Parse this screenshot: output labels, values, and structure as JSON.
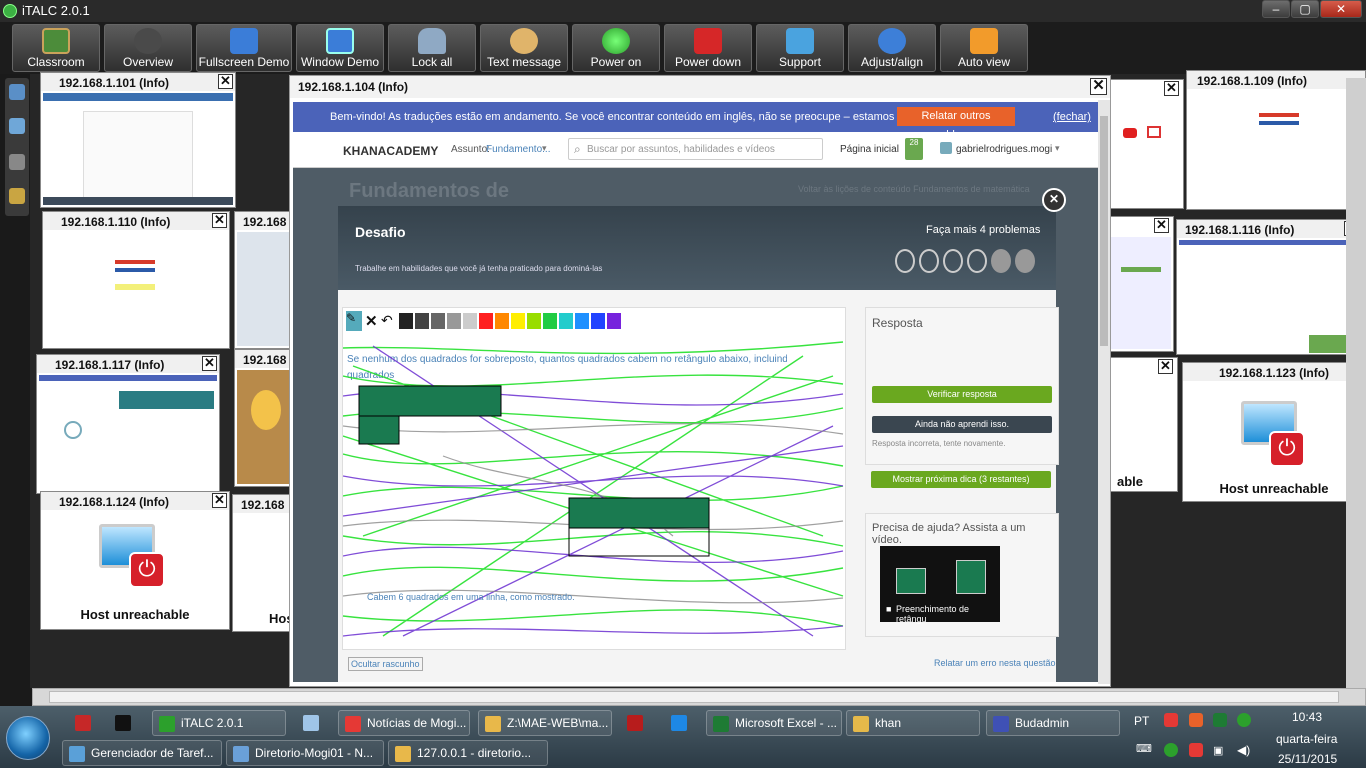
{
  "window": {
    "title": "iTALC 2.0.1",
    "controls": {
      "min": "‒",
      "max": "▢",
      "close": "✕"
    }
  },
  "toolbar": [
    {
      "label": "Classroom",
      "icon": "classroom-icon",
      "color": "#4c8c3a"
    },
    {
      "label": "Overview",
      "icon": "binoculars-icon",
      "color": "#4a4a4a"
    },
    {
      "label": "Fullscreen Demo",
      "icon": "fullscreen-demo-icon",
      "color": "#3b7dd8"
    },
    {
      "label": "Window Demo",
      "icon": "window-demo-icon",
      "color": "#3b7dd8"
    },
    {
      "label": "Lock all",
      "icon": "lock-icon",
      "color": "#8fa9c4"
    },
    {
      "label": "Text message",
      "icon": "text-message-icon",
      "color": "#e0b46a"
    },
    {
      "label": "Power on",
      "icon": "power-on-icon",
      "color": "#2ca02c"
    },
    {
      "label": "Power down",
      "icon": "power-down-icon",
      "color": "#d62728"
    },
    {
      "label": "Support",
      "icon": "support-icon",
      "color": "#4aa3df"
    },
    {
      "label": "Adjust/align",
      "icon": "adjust-align-icon",
      "color": "#3d7fd8"
    },
    {
      "label": "Auto view",
      "icon": "auto-view-icon",
      "color": "#f29b2b"
    }
  ],
  "thumbs": {
    "t101": "192.168.1.101 (Info)",
    "t110": "192.168.1.110 (Info)",
    "t117": "192.168.1.117 (Info)",
    "t124": "192.168.1.124 (Info)",
    "t109": "192.168.1.109 (Info)",
    "t116": "192.168.1.116 (Info)",
    "t123": "192.168.1.123 (Info)",
    "p1": "192.168",
    "p2": "192.168",
    "p3": "192.168",
    "unreach": "Host unreachable",
    "hos": "Hos",
    "able": "able",
    "close": "✕"
  },
  "main": {
    "title": "192.168.1.104 (Info)",
    "banner": "Bem-vindo! As traduções estão em andamento. Se você encontrar conteúdo em inglês, não se preocupe – estamos trabalhando nisso.",
    "report_other": "Relatar outros problemas",
    "close_banner": "(fechar)",
    "logo": "KHANACADEMY",
    "subject_label": "Assunto:",
    "subject_value": "Fundamento...",
    "search_placeholder": "Buscar por assuntos, habilidades e vídeos",
    "home": "Página inicial",
    "points": "28",
    "user": "gabrielrodrigues.mogi",
    "page_title": "Fundamentos de",
    "crumb": "Voltar às lições de conteúdo Fundamentos de matemática",
    "challenge_title": "Desafio",
    "challenge_sub": "Trabalhe em habilidades que você já tenha praticado para dominá-las",
    "do_more": "Faça mais 4 problemas",
    "question": "Se nenhum dos quadrados for sobreposto, quantos quadrados cabem no retângulo abaixo, incluindo os mostrados?",
    "unit": "quadrados",
    "hint_text": "Cabem 6 quadrados em uma linha, como mostrado.",
    "hide_scratch": "Ocultar rascunho",
    "report_error": "Relatar um erro nesta questão",
    "answer_label": "Resposta",
    "check_btn": "Verificar resposta",
    "not_learned_btn": "Ainda não aprendi isso.",
    "incorrect": "Resposta incorreta, tente novamente.",
    "next_hint_btn": "Mostrar próxima dica (3 restantes)",
    "help_title": "Precisa de ajuda? Assista a um vídeo.",
    "video_title": "Preenchimento de retângu",
    "modal_close": "✕",
    "palette": [
      "#222222",
      "#444444",
      "#666666",
      "#999999",
      "#cccccc",
      "#ff2020",
      "#ff8800",
      "#ffee00",
      "#99dd00",
      "#22cc44",
      "#22cccc",
      "#1e90ff",
      "#2244ff",
      "#7722dd"
    ]
  },
  "taskbar": {
    "items": [
      {
        "label": "",
        "icon": "ve-icon",
        "color": "#c62828"
      },
      {
        "label": "",
        "icon": "cmd-icon",
        "color": "#111111"
      },
      {
        "label": "iTALC 2.0.1",
        "icon": "italc-icon",
        "color": "#2ca02c"
      },
      {
        "label": "",
        "icon": "notepad-icon",
        "color": "#9fc5e8"
      },
      {
        "label": "Notícias de Mogi...",
        "icon": "chrome-icon",
        "color": "#e53935"
      },
      {
        "label": "Z:\\MAE-WEB\\ma...",
        "icon": "editor-icon",
        "color": "#e8b84a"
      },
      {
        "label": "",
        "icon": "filezilla-icon",
        "color": "#b71c1c"
      },
      {
        "label": "",
        "icon": "ie-icon",
        "color": "#1e88e5"
      },
      {
        "label": "Microsoft Excel - ...",
        "icon": "excel-icon",
        "color": "#1e7b34"
      },
      {
        "label": "khan",
        "icon": "folder-icon",
        "color": "#e5b94a"
      },
      {
        "label": "Budadmin",
        "icon": "budadmin-icon",
        "color": "#3f51b5"
      },
      {
        "label": "Gerenciador de Taref...",
        "icon": "task-manager-icon",
        "color": "#5aa0d8"
      },
      {
        "label": "Diretorio-Mogi01 - N...",
        "icon": "network-icon",
        "color": "#6aa0d8"
      },
      {
        "label": "127.0.0.1 - diretorio...",
        "icon": "server-icon",
        "color": "#e8b84a"
      }
    ],
    "lang": "PT",
    "time": "10:43",
    "weekday": "quarta-feira",
    "date": "25/11/2015"
  }
}
